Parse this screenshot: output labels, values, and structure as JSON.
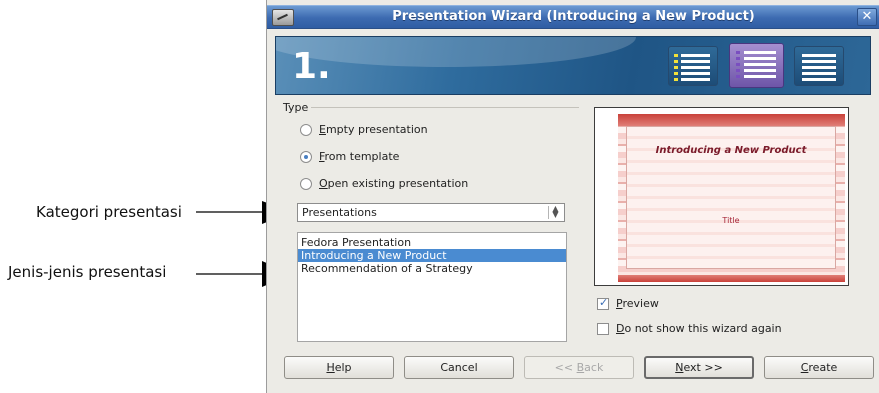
{
  "annotations": {
    "category": "Kategori presentasi",
    "types": "Jenis-jenis presentasi"
  },
  "window": {
    "title": "Presentation Wizard (Introducing a New Product)",
    "close_glyph": "✕"
  },
  "banner": {
    "step": "1."
  },
  "type_group": {
    "label": "Type",
    "options": [
      {
        "mnemonic": "E",
        "rest": "mpty presentation",
        "checked": false
      },
      {
        "mnemonic": "F",
        "rest": "rom template",
        "checked": true
      },
      {
        "mnemonic": "O",
        "rest": "pen existing presentation",
        "checked": false
      }
    ]
  },
  "category_select": {
    "value": "Presentations"
  },
  "template_list": {
    "items": [
      {
        "label": "Fedora Presentation",
        "selected": false
      },
      {
        "label": "Introducing a New Product",
        "selected": true
      },
      {
        "label": "Recommendation of a Strategy",
        "selected": false
      }
    ]
  },
  "preview": {
    "slide_title": "Introducing a New Product",
    "slide_subtitle": "Title"
  },
  "checks": {
    "preview": {
      "mnemonic": "P",
      "rest": "review",
      "checked": true
    },
    "no_show": {
      "mnemonic": "D",
      "rest": "o not show this wizard again",
      "checked": false
    }
  },
  "buttons": {
    "help": {
      "mnemonic": "H",
      "rest": "elp"
    },
    "cancel": "Cancel",
    "back": {
      "pre": "<< ",
      "mnemonic": "B",
      "rest": "ack"
    },
    "next": {
      "mnemonic": "N",
      "rest": "ext >>"
    },
    "create": {
      "mnemonic": "C",
      "rest": "reate"
    }
  },
  "colors": {
    "titlebar": "#3c6ab0",
    "selection": "#4a8bd1",
    "banner": "#2f6c9e"
  }
}
